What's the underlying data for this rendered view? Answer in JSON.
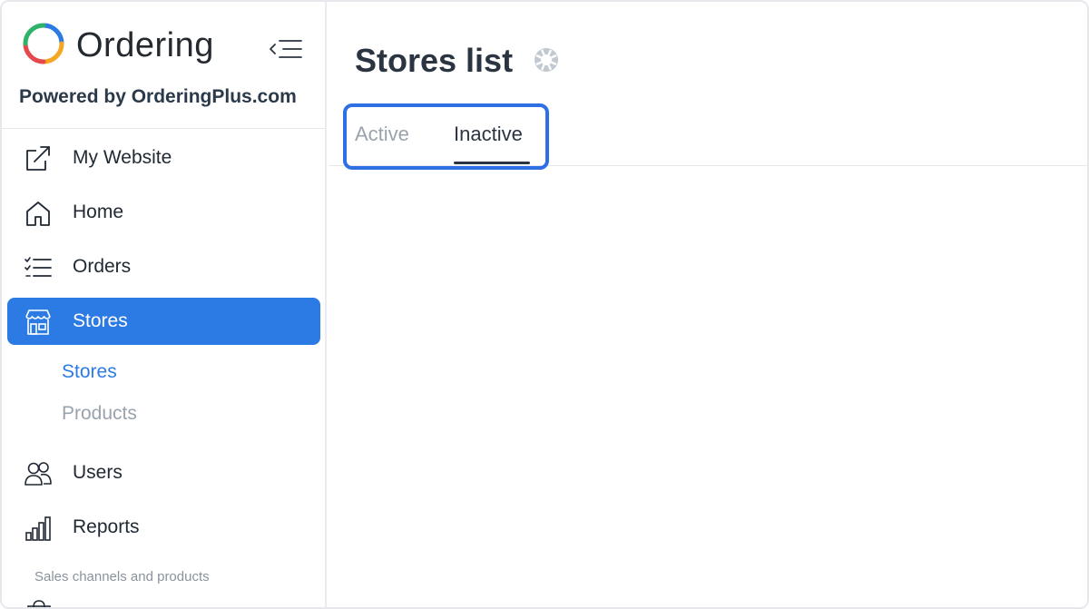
{
  "brand": {
    "name": "Ordering",
    "powered_by": "Powered by OrderingPlus.com"
  },
  "sidebar": {
    "items": [
      {
        "label": "My Website",
        "icon": "external-link-icon"
      },
      {
        "label": "Home",
        "icon": "home-icon"
      },
      {
        "label": "Orders",
        "icon": "list-icon"
      },
      {
        "label": "Stores",
        "icon": "store-icon",
        "active": true
      },
      {
        "label": "Users",
        "icon": "users-icon"
      },
      {
        "label": "Reports",
        "icon": "bar-chart-icon"
      }
    ],
    "sub_items": [
      {
        "label": "Stores",
        "current": true
      },
      {
        "label": "Products",
        "current": false
      }
    ],
    "section_label": "Sales channels and products"
  },
  "main": {
    "title": "Stores list",
    "tabs": [
      {
        "label": "Active",
        "selected": false
      },
      {
        "label": "Inactive",
        "selected": true
      }
    ]
  },
  "colors": {
    "accent": "#2c7be5",
    "highlight_border": "#2f6fe4",
    "text_dark": "#2b3441",
    "text_muted": "#9aa3ad"
  }
}
